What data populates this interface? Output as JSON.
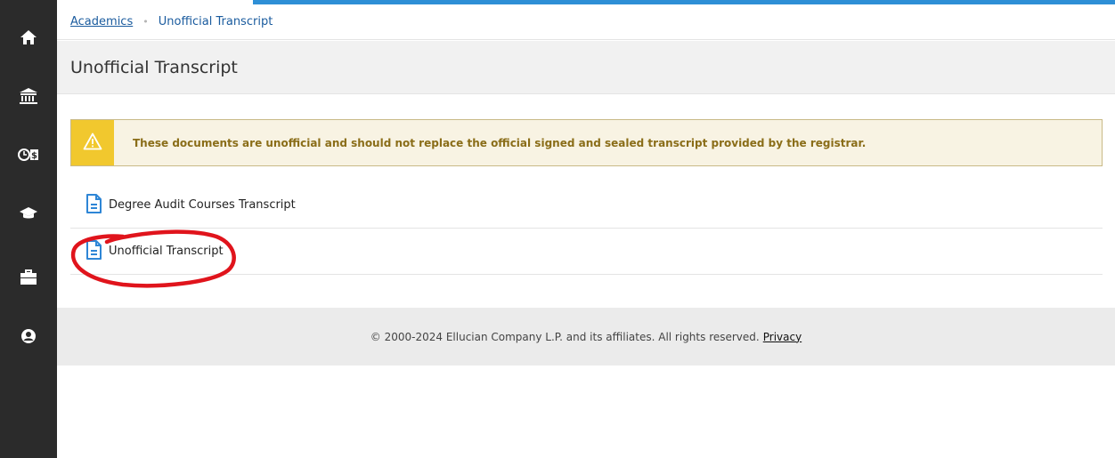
{
  "sidebar": {
    "items": [
      {
        "icon": "home-icon"
      },
      {
        "icon": "bank-icon"
      },
      {
        "icon": "clock-dollar-icon"
      },
      {
        "icon": "graduation-cap-icon"
      },
      {
        "icon": "briefcase-icon"
      },
      {
        "icon": "user-circle-icon"
      }
    ]
  },
  "breadcrumb": {
    "parent": "Academics",
    "separator": "•",
    "current": "Unofficial Transcript"
  },
  "page": {
    "title": "Unofficial Transcript"
  },
  "alert": {
    "icon": "warning-icon",
    "text": "These documents are unofficial and should not replace the official signed and sealed transcript provided by the registrar.",
    "colors": {
      "icon_bg": "#f1c82e",
      "text": "#8a6d18",
      "bg": "#f8f3e3"
    }
  },
  "documents": [
    {
      "label": "Degree Audit Courses Transcript",
      "icon": "document-icon"
    },
    {
      "label": "Unofficial Transcript",
      "icon": "document-icon"
    }
  ],
  "footer": {
    "copyright": "© 2000-2024 Ellucian Company L.P. and its affiliates. All rights reserved.",
    "privacy_link": "Privacy"
  },
  "colors": {
    "accent": "#2e8fd6",
    "link": "#1a5b9e",
    "sidebar_bg": "#2b2b2b",
    "annotation": "#e0141c"
  }
}
